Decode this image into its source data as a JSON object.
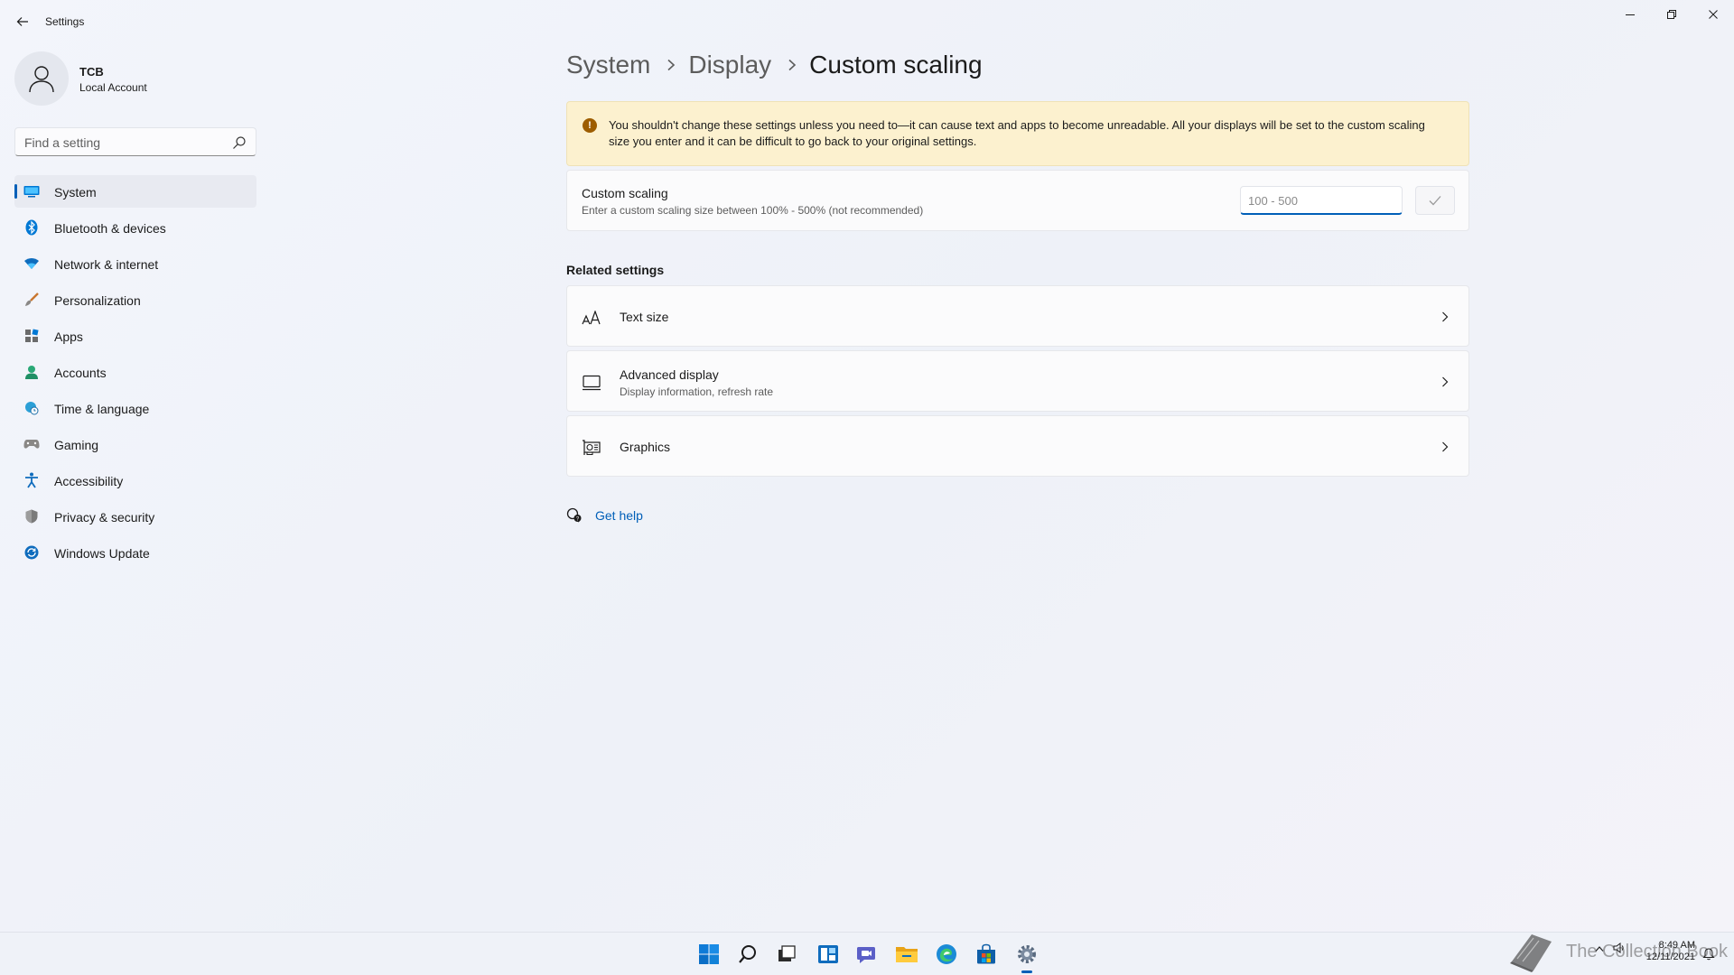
{
  "window": {
    "title": "Settings",
    "controls": [
      "minimize-icon",
      "restore-icon",
      "close-icon"
    ]
  },
  "user": {
    "name": "TCB",
    "account_type": "Local Account"
  },
  "search": {
    "placeholder": "Find a setting",
    "value": ""
  },
  "sidebar": {
    "items": [
      {
        "label": "System",
        "icon": "system-display-icon",
        "active": true
      },
      {
        "label": "Bluetooth & devices",
        "icon": "bluetooth-icon",
        "active": false
      },
      {
        "label": "Network & internet",
        "icon": "wifi-icon",
        "active": false
      },
      {
        "label": "Personalization",
        "icon": "brush-icon",
        "active": false
      },
      {
        "label": "Apps",
        "icon": "apps-icon",
        "active": false
      },
      {
        "label": "Accounts",
        "icon": "account-icon",
        "active": false
      },
      {
        "label": "Time & language",
        "icon": "globe-clock-icon",
        "active": false
      },
      {
        "label": "Gaming",
        "icon": "gamepad-icon",
        "active": false
      },
      {
        "label": "Accessibility",
        "icon": "accessibility-icon",
        "active": false
      },
      {
        "label": "Privacy & security",
        "icon": "shield-icon",
        "active": false
      },
      {
        "label": "Windows Update",
        "icon": "update-icon",
        "active": false
      }
    ]
  },
  "breadcrumb": {
    "items": [
      "System",
      "Display"
    ],
    "current": "Custom scaling"
  },
  "warning": {
    "text": "You shouldn't change these settings unless you need to—it can cause text and apps to become unreadable. All your displays will be set to the custom scaling size you enter and it can be difficult to go back to your original settings."
  },
  "custom_scaling": {
    "title": "Custom scaling",
    "subtitle": "Enter a custom scaling size between 100% - 500% (not recommended)",
    "input_placeholder": "100 - 500",
    "input_value": ""
  },
  "related": {
    "heading": "Related settings",
    "items": [
      {
        "title": "Text size",
        "subtitle": "",
        "icon": "text-size-icon"
      },
      {
        "title": "Advanced display",
        "subtitle": "Display information, refresh rate",
        "icon": "monitor-icon"
      },
      {
        "title": "Graphics",
        "subtitle": "",
        "icon": "graphics-card-icon"
      }
    ]
  },
  "help": {
    "label": "Get help"
  },
  "taskbar": {
    "apps": [
      "start-icon",
      "search-icon",
      "task-view-icon",
      "widgets-icon",
      "chat-icon",
      "file-explorer-icon",
      "edge-icon",
      "store-icon",
      "settings-icon"
    ],
    "watermark": "The Collection Book",
    "time": "8:49 AM",
    "date": "12/11/2021"
  },
  "colors": {
    "accent": "#005fb8",
    "warning_bg": "#fcf1cf",
    "warning_icon": "#9d5d00"
  }
}
